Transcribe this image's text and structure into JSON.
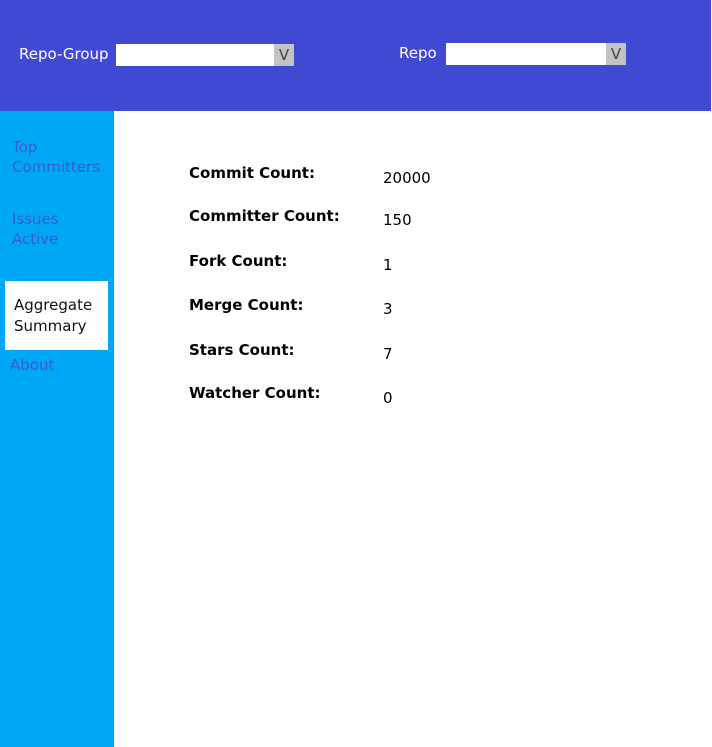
{
  "header": {
    "repo_group_label": "Repo-Group",
    "repo_group_value": "",
    "repo_label": "Repo",
    "repo_value": "",
    "dropdown_glyph": "V"
  },
  "sidebar": {
    "items": [
      {
        "label_line1": "Top",
        "label_line2": "Committers"
      },
      {
        "label_line1": "Issues",
        "label_line2": "Active"
      },
      {
        "label_line1": "Aggregate",
        "label_line2": "Summary"
      },
      {
        "label_line1": "About"
      }
    ]
  },
  "summary": {
    "rows": [
      {
        "label": "Commit Count:",
        "value": "20000"
      },
      {
        "label": "Committer Count:",
        "value": "150"
      },
      {
        "label": "Fork Count:",
        "value": "1"
      },
      {
        "label": "Merge Count:",
        "value": "3"
      },
      {
        "label": "Stars Count:",
        "value": "7"
      },
      {
        "label": "Watcher Count:",
        "value": "0"
      }
    ]
  },
  "colors": {
    "header_bg": "#4049d2",
    "sidebar_bg": "#00a7f4",
    "nav_link": "#3b5ad8"
  }
}
